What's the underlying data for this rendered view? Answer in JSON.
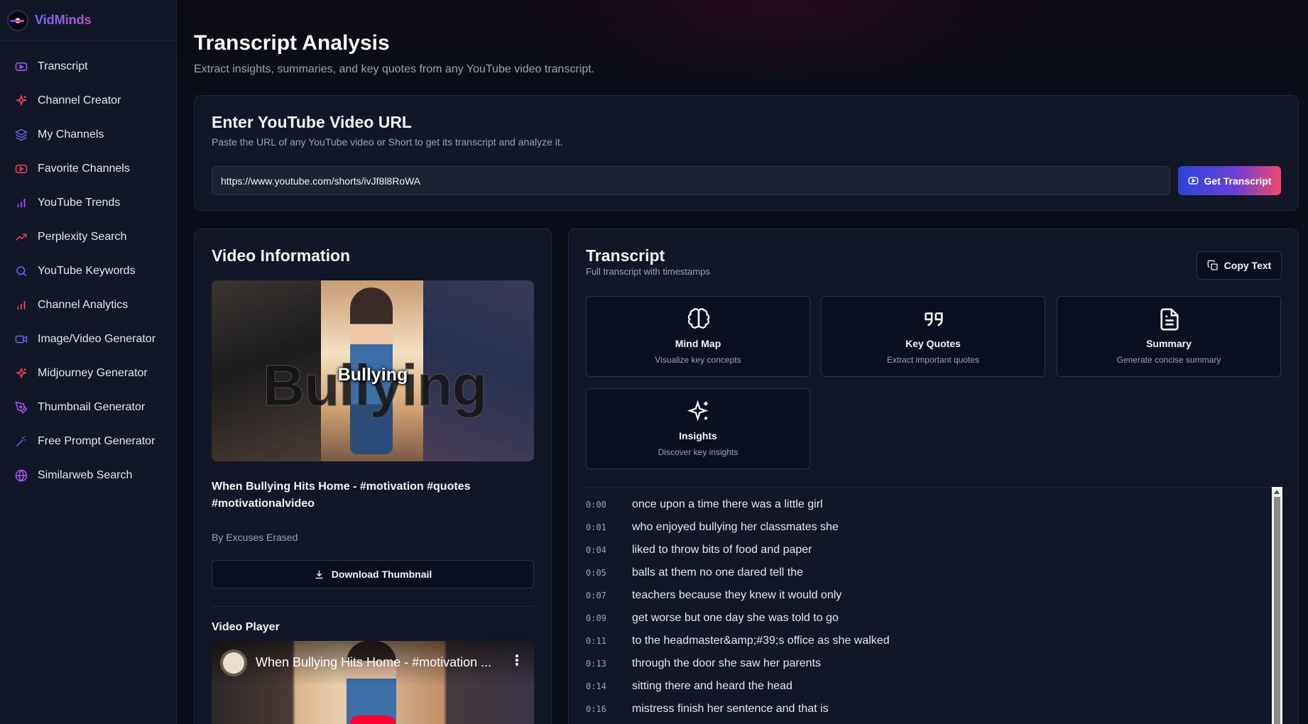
{
  "brand": {
    "name": "VidMinds"
  },
  "sidebar": {
    "items": [
      {
        "label": "Transcript",
        "icon": "youtube-icon",
        "color": "#a855f7"
      },
      {
        "label": "Channel Creator",
        "icon": "sparkles-icon",
        "color": "#f43f5e"
      },
      {
        "label": "My Channels",
        "icon": "layers-icon",
        "color": "#6366f1"
      },
      {
        "label": "Favorite Channels",
        "icon": "youtube-icon",
        "color": "#f43f5e"
      },
      {
        "label": "YouTube Trends",
        "icon": "bar-chart-icon",
        "color": "#a855f7"
      },
      {
        "label": "Perplexity Search",
        "icon": "trending-up-icon",
        "color": "#f43f5e"
      },
      {
        "label": "YouTube Keywords",
        "icon": "search-icon",
        "color": "#6366f1"
      },
      {
        "label": "Channel Analytics",
        "icon": "bar-chart-icon",
        "color": "#f43f5e"
      },
      {
        "label": "Image/Video Generator",
        "icon": "video-icon",
        "color": "#6366f1"
      },
      {
        "label": "Midjourney Generator",
        "icon": "sparkles-icon",
        "color": "#f43f5e"
      },
      {
        "label": "Thumbnail Generator",
        "icon": "pen-tool-icon",
        "color": "#a855f7"
      },
      {
        "label": "Free Prompt Generator",
        "icon": "wand-icon",
        "color": "#6366f1"
      },
      {
        "label": "Similarweb Search",
        "icon": "globe-icon",
        "color": "#a855f7"
      }
    ]
  },
  "header": {
    "title": "Transcript Analysis",
    "subtitle": "Extract insights, summaries, and key quotes from any YouTube video transcript."
  },
  "url_card": {
    "title": "Enter YouTube Video URL",
    "subtitle": "Paste the URL of any YouTube video or Short to get its transcript and analyze it.",
    "url_value": "https://www.youtube.com/shorts/ivJf8l8RoWA",
    "button_label": "Get Transcript"
  },
  "video_info": {
    "heading": "Video Information",
    "thumbnail_text": "Bullying",
    "title": "When Bullying Hits Home - #motivation #quotes #motivationalvideo",
    "author": "By Excuses Erased",
    "download_label": "Download Thumbnail",
    "player_heading": "Video Player",
    "player_title": "When Bullying Hits Home - #motivation ..."
  },
  "transcript": {
    "heading": "Transcript",
    "subtitle": "Full transcript with timestamps",
    "copy_label": "Copy Text",
    "tools": [
      {
        "label": "Mind Map",
        "desc": "Visualize key concepts",
        "icon": "brain-icon"
      },
      {
        "label": "Key Quotes",
        "desc": "Extract important quotes",
        "icon": "quote-icon"
      },
      {
        "label": "Summary",
        "desc": "Generate concise summary",
        "icon": "file-text-icon"
      },
      {
        "label": "Insights",
        "desc": "Discover key insights",
        "icon": "sparkles-icon"
      }
    ],
    "lines": [
      {
        "t": "0:00",
        "text": "once upon a time there was a little girl"
      },
      {
        "t": "0:01",
        "text": "who enjoyed bullying her classmates she"
      },
      {
        "t": "0:04",
        "text": "liked to throw bits of food and paper"
      },
      {
        "t": "0:05",
        "text": "balls at them no one dared tell the"
      },
      {
        "t": "0:07",
        "text": "teachers because they knew it would only"
      },
      {
        "t": "0:09",
        "text": "get worse but one day she was told to go"
      },
      {
        "t": "0:11",
        "text": "to the headmaster&amp;#39;s office as she walked"
      },
      {
        "t": "0:13",
        "text": "through the door she saw her parents"
      },
      {
        "t": "0:14",
        "text": "sitting there and heard the head"
      },
      {
        "t": "0:16",
        "text": "mistress finish her sentence and that is"
      }
    ]
  }
}
